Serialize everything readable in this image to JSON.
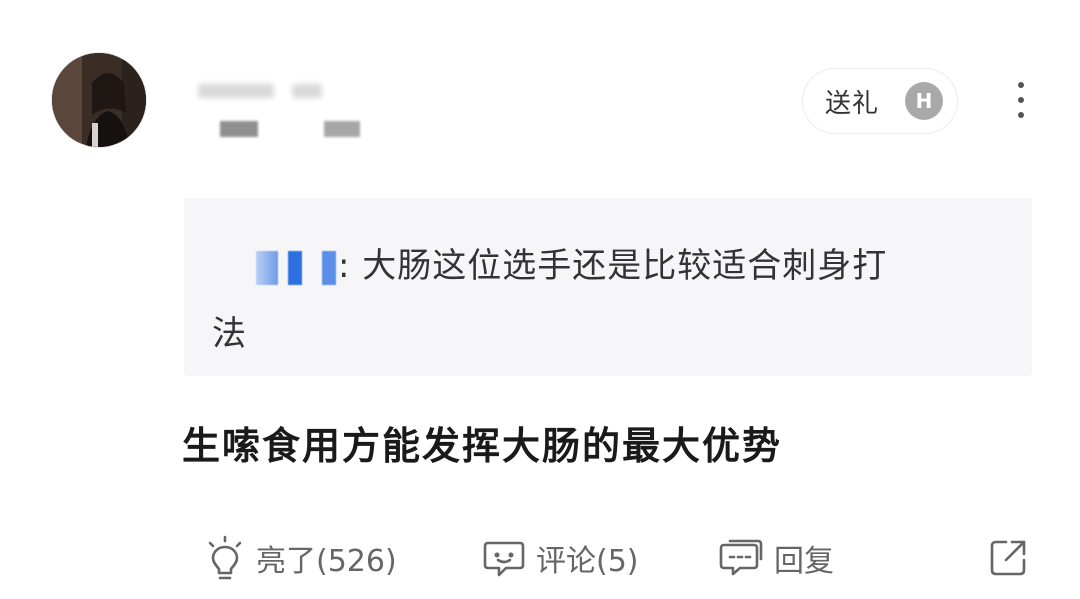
{
  "comment": {
    "gift_label": "送礼",
    "gift_badge": "H",
    "quote": {
      "separator": ": ",
      "text_line1": "大肠这位选手还是比较适合刺身打",
      "text_line2": "法"
    },
    "body": "生嗦食用方能发挥大肠的最大优势",
    "actions": {
      "like_label": "亮了(526)",
      "comment_label": "评论(5)",
      "reply_label": "回复"
    }
  },
  "icons": {
    "like": "lightbulb-icon",
    "comment": "comment-bubble-icon",
    "reply": "reply-bubble-icon",
    "share": "share-icon",
    "more": "more-vertical-icon",
    "gift": "h-badge-icon"
  },
  "colors": {
    "quote_background": "#f6f6f8",
    "text_primary": "#1a1a1a",
    "text_secondary": "#666666"
  }
}
